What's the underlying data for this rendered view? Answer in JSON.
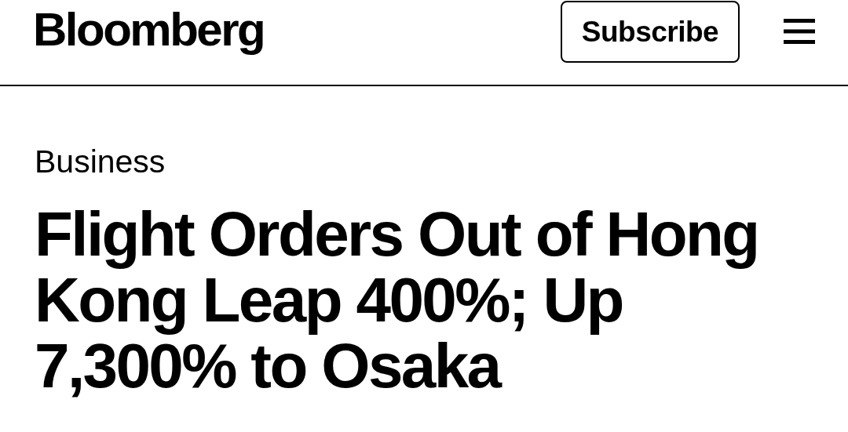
{
  "header": {
    "logo": "Bloomberg",
    "subscribe_button": "Subscribe"
  },
  "article": {
    "section": "Business",
    "headline": "Flight Orders Out of Hong Kong Leap 400%; Up 7,300% to Osaka"
  }
}
